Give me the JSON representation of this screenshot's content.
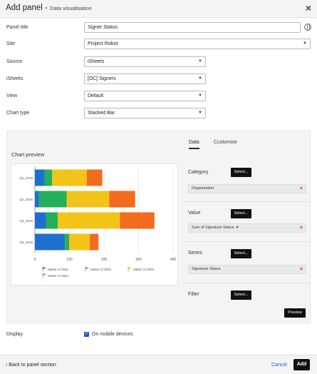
{
  "header": {
    "title": "Add panel",
    "separator": " - ",
    "subtitle": "Data visualisation"
  },
  "form": {
    "panel_title_label": "Panel title",
    "panel_title_value": "Signer Status",
    "site_label": "Site",
    "site_value": "Project Robot",
    "source_label": "Source",
    "source_value": "iSheets",
    "isheets_label": "iSheets",
    "isheets_value": "[DC] Signers",
    "view_label": "View",
    "view_value": "Default",
    "chart_type_label": "Chart type",
    "chart_type_value": "Stacked Bar"
  },
  "tabs": [
    "Data",
    "Customise"
  ],
  "preview": {
    "title": "Chart preview"
  },
  "config": {
    "category_label": "Category",
    "category_value": "Organization",
    "value_label": "Value",
    "value_value": "Sum of Signature Status",
    "series_label": "Series",
    "series_value": "Signature Status",
    "filter_label": "Filter",
    "select_label": "Select...",
    "preview_label": "Preview"
  },
  "display": {
    "label": "Display",
    "checkbox_label": "On mobile devices",
    "checked": true
  },
  "footer": {
    "back_label": "Back to panel section",
    "cancel_label": "Cancel",
    "add_label": "Add"
  },
  "colors": {
    "accent_blue": "#1e58c8",
    "button_dark": "#111111",
    "remove_red": "#d22222"
  },
  "chart_data": {
    "type": "bar",
    "orientation": "horizontal",
    "stacked": true,
    "categories": [
      "Q1_2016",
      "Q2_2016",
      "Q3_2016",
      "Q4_2016"
    ],
    "series": [
      {
        "name": "Matter Id 2501",
        "color": "#1f6fcf",
        "values": [
          28,
          12,
          32,
          87
        ]
      },
      {
        "name": "Matter Id 2502",
        "color": "#22b05b",
        "values": [
          22,
          80,
          34,
          12
        ]
      },
      {
        "name": "Matter Id 2503",
        "color": "#f2c318",
        "values": [
          100,
          123,
          180,
          60
        ]
      },
      {
        "name": "Matter Id 2504",
        "color": "#f36b1c",
        "values": [
          45,
          75,
          100,
          25
        ]
      }
    ],
    "xlim": [
      0,
      400
    ],
    "xticks": [
      0,
      100,
      200,
      300,
      400
    ],
    "legend_position": "bottom"
  }
}
